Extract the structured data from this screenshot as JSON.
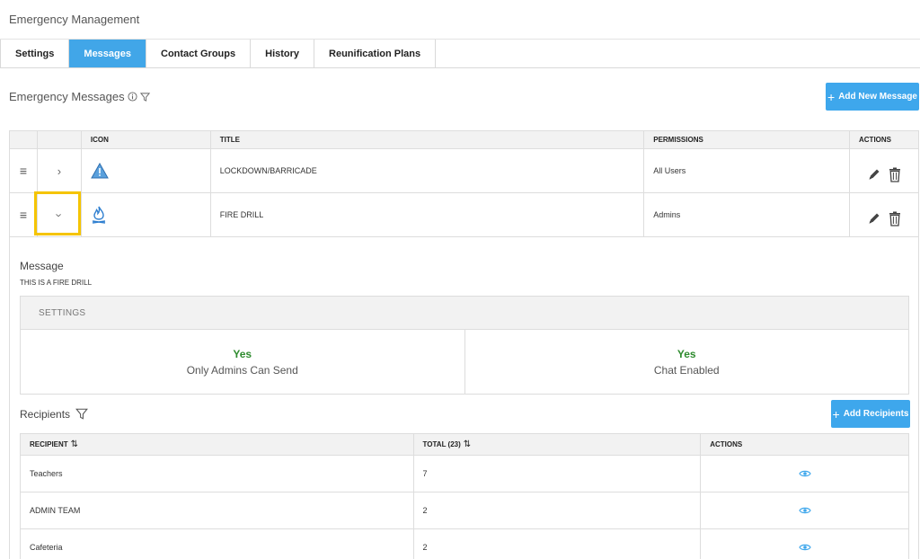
{
  "app": {
    "title": "Emergency Management"
  },
  "tabs": [
    {
      "label": "Settings",
      "active": false
    },
    {
      "label": "Messages",
      "active": true
    },
    {
      "label": "Contact Groups",
      "active": false
    },
    {
      "label": "History",
      "active": false
    },
    {
      "label": "Reunification Plans",
      "active": false
    }
  ],
  "messages_section": {
    "title": "Emergency Messages",
    "add_button": "Add New Message",
    "columns": [
      "ICON",
      "TITLE",
      "PERMISSIONS",
      "ACTIONS"
    ],
    "rows": [
      {
        "icon": "warning-triangle-icon",
        "title": "LOCKDOWN/BARRICADE",
        "permissions": "All Users",
        "expanded": false
      },
      {
        "icon": "fire-icon",
        "title": "FIRE DRILL",
        "permissions": "Admins",
        "expanded": true
      }
    ]
  },
  "detail": {
    "message_label": "Message",
    "message_text": "THIS IS A FIRE DRILL",
    "settings_header": "SETTINGS",
    "settings": [
      {
        "value": "Yes",
        "label": "Only Admins Can Send"
      },
      {
        "value": "Yes",
        "label": "Chat Enabled"
      }
    ],
    "recipients_title": "Recipients",
    "add_recipients_button": "Add Recipients",
    "recipient_columns": [
      "RECIPIENT",
      "TOTAL (23)",
      "ACTIONS"
    ],
    "recipients": [
      {
        "name": "Teachers",
        "total": "7"
      },
      {
        "name": "ADMIN TEAM",
        "total": "2"
      },
      {
        "name": "Cafeteria",
        "total": "2"
      }
    ]
  },
  "colors": {
    "accent": "#3ea7ec",
    "tab_active": "#41a6e8",
    "success": "#2e8b2e",
    "highlight": "#f5c400"
  }
}
